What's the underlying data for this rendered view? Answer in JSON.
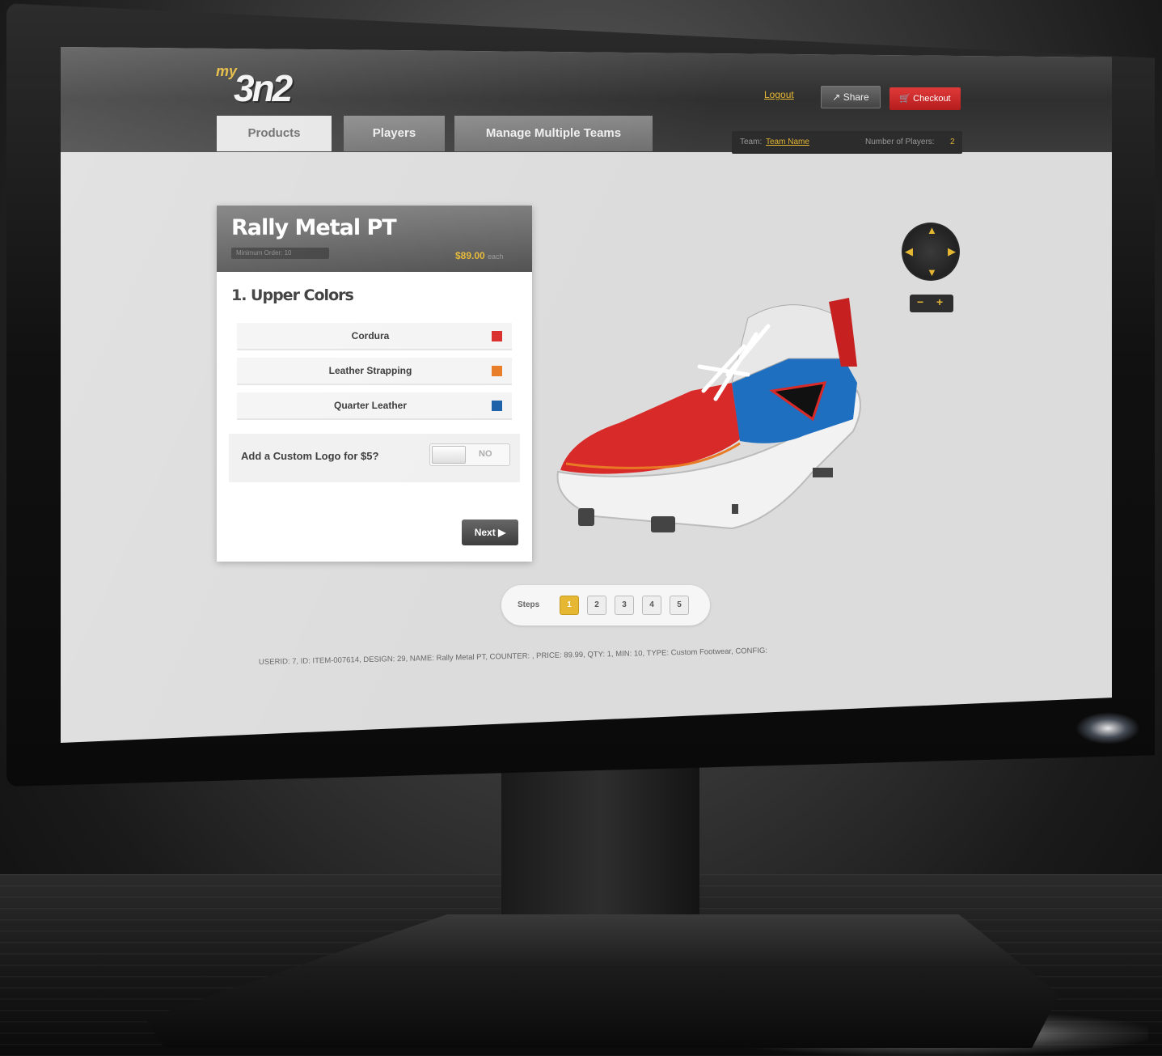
{
  "app": {
    "logo_prefix": "my",
    "logo_main": "3n2"
  },
  "header": {
    "logout_label": "Logout",
    "share_label": "Share",
    "checkout_label": "Checkout"
  },
  "tabs": [
    {
      "label": "Products",
      "active": true
    },
    {
      "label": "Players",
      "active": false
    },
    {
      "label": "Manage Multiple Teams",
      "active": false
    }
  ],
  "team_bar": {
    "team_label": "Team:",
    "team_name": "Team Name",
    "players_label": "Number of Players:",
    "players_count": "2"
  },
  "product": {
    "name": "Rally Metal PT",
    "min_order": "Minimum Order: 10",
    "price": "$89.00",
    "price_unit": "each"
  },
  "step_section": {
    "title": "1. Upper Colors",
    "colors": [
      {
        "label": "Cordura",
        "color": "#d92a2a"
      },
      {
        "label": "Leather Strapping",
        "color": "#e87a25"
      },
      {
        "label": "Quarter Leather",
        "color": "#1a5fa8"
      }
    ],
    "custom_logo_question": "Add a Custom Logo for $5?",
    "custom_logo_value": "NO",
    "next_label": "Next"
  },
  "steps": {
    "label": "Steps",
    "items": [
      "1",
      "2",
      "3",
      "4",
      "5"
    ],
    "active": 1
  },
  "debug_line": "USERID: 7, ID: ITEM-007614, DESIGN: 29, NAME: Rally Metal PT, COUNTER: , PRICE: 89.99, QTY: 1, MIN: 10, TYPE: Custom Footwear, CONFIG:",
  "colors": {
    "accent": "#e5b732",
    "checkout": "#d62828",
    "shoe_red": "#d92a2a",
    "shoe_blue": "#1f6fc0"
  }
}
